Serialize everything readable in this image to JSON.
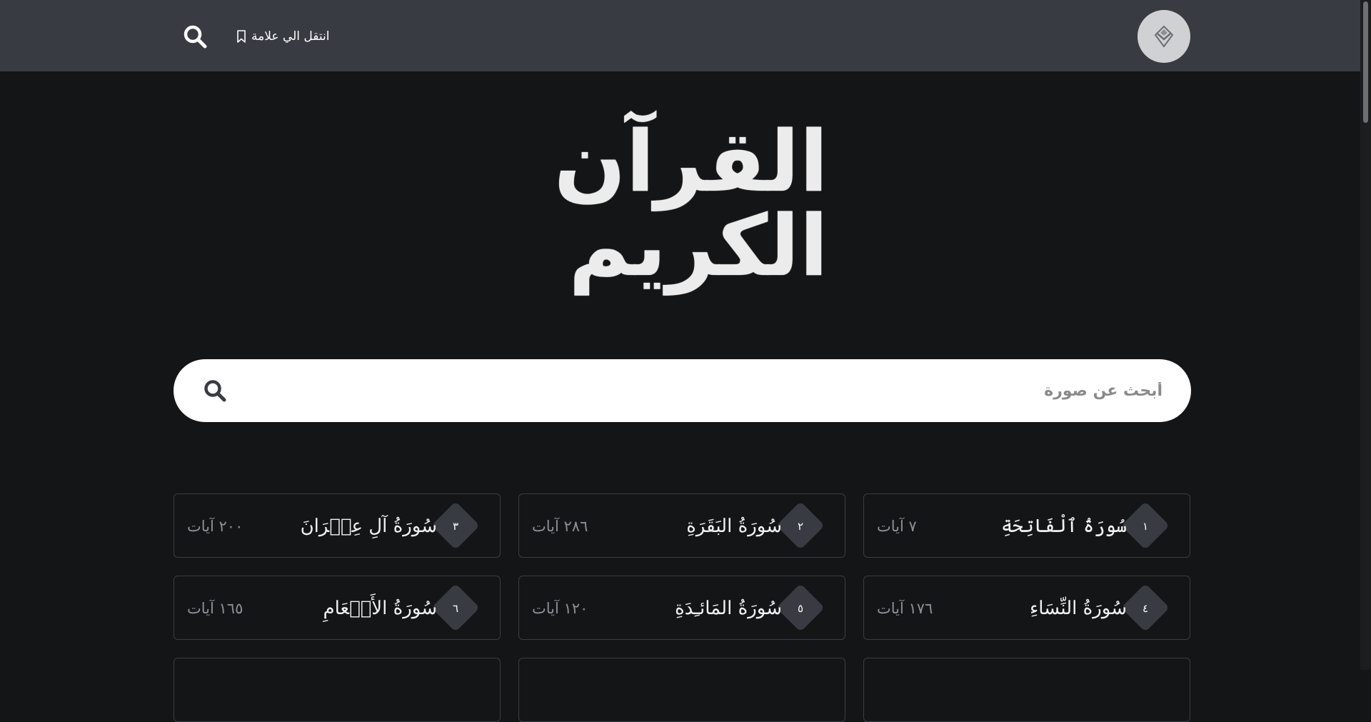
{
  "header": {
    "bookmark_label": "انتقل الي علامة"
  },
  "hero": {
    "title": "القرآن الكريم"
  },
  "search": {
    "placeholder": "أبحث عن صورة"
  },
  "surahs": [
    {
      "number": "١",
      "name": "سُورَةُ ٱلْفَاتِحَةِ",
      "ayat": "٧ آيات"
    },
    {
      "number": "٢",
      "name": "سُورَةُ البَقَرَةِ",
      "ayat": "٢٨٦ آيات"
    },
    {
      "number": "٣",
      "name": "سُورَةُ آلِ عِمۡرَانَ",
      "ayat": "٢٠٠ آيات"
    },
    {
      "number": "٤",
      "name": "سُورَةُ النِّسَاءِ",
      "ayat": "١٧٦ آيات"
    },
    {
      "number": "٥",
      "name": "سُورَةُ المَائـِدَةِ",
      "ayat": "١٢٠ آيات"
    },
    {
      "number": "٦",
      "name": "سُورَةُ الأَنۡعَامِ",
      "ayat": "١٦٥ آيات"
    }
  ],
  "colors": {
    "header_bg": "#383b41",
    "page_bg": "#141517",
    "card_border": "#3a3d42"
  }
}
